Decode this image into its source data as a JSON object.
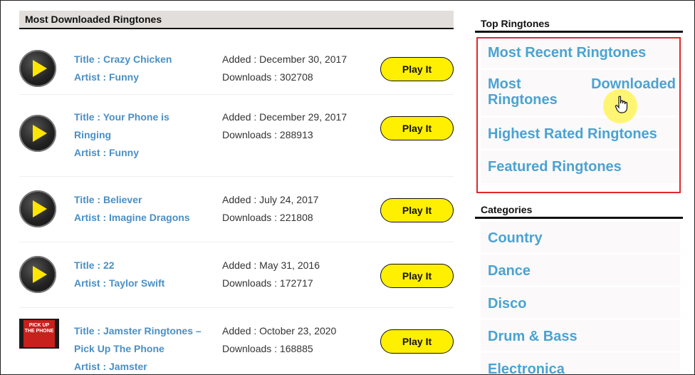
{
  "main": {
    "section_title": "Most Downloaded Ringtones",
    "rows": [
      {
        "title": "Title : Crazy Chicken",
        "artist": "Artist : Funny",
        "added": "Added : December 30, 2017",
        "downloads": "Downloads : 302708",
        "button": "Play It"
      },
      {
        "title_line1": "Title : Your Phone is",
        "title_line2": "Ringing",
        "artist": "Artist : Funny",
        "added": "Added : December 29, 2017",
        "downloads": "Downloads : 288913",
        "button": "Play It"
      },
      {
        "title": "Title : Believer",
        "artist": "Artist : Imagine Dragons",
        "added": "Added : July 24, 2017",
        "downloads": "Downloads : 221808",
        "button": "Play It"
      },
      {
        "title": "Title : 22",
        "artist": "Artist : Taylor Swift",
        "added": "Added : May 31, 2016",
        "downloads": "Downloads : 172717",
        "button": "Play It"
      },
      {
        "title_line1": "Title : Jamster Ringtones –",
        "title_line2": "Pick Up The Phone",
        "artist": "Artist : Jamster",
        "added": "Added : October 23, 2020",
        "downloads": "Downloads : 168885",
        "button": "Play It",
        "thumb_text": "PICK UP THE PHONE"
      }
    ]
  },
  "sidebar": {
    "top_title": "Top Ringtones",
    "top_items": [
      {
        "label": "Most Recent Ringtones"
      },
      {
        "label_a": "Most",
        "label_b": "Downloaded",
        "label_c": "Ringtones"
      },
      {
        "label": "Highest Rated Ringtones"
      },
      {
        "label": "Featured Ringtones"
      }
    ],
    "categories_title": "Categories",
    "categories": [
      "Country",
      "Dance",
      "Disco",
      "Drum & Bass",
      "Electronica"
    ]
  },
  "colors": {
    "link": "#4aa3d2",
    "button": "#ffef00",
    "highlight_border": "#e0282a"
  }
}
